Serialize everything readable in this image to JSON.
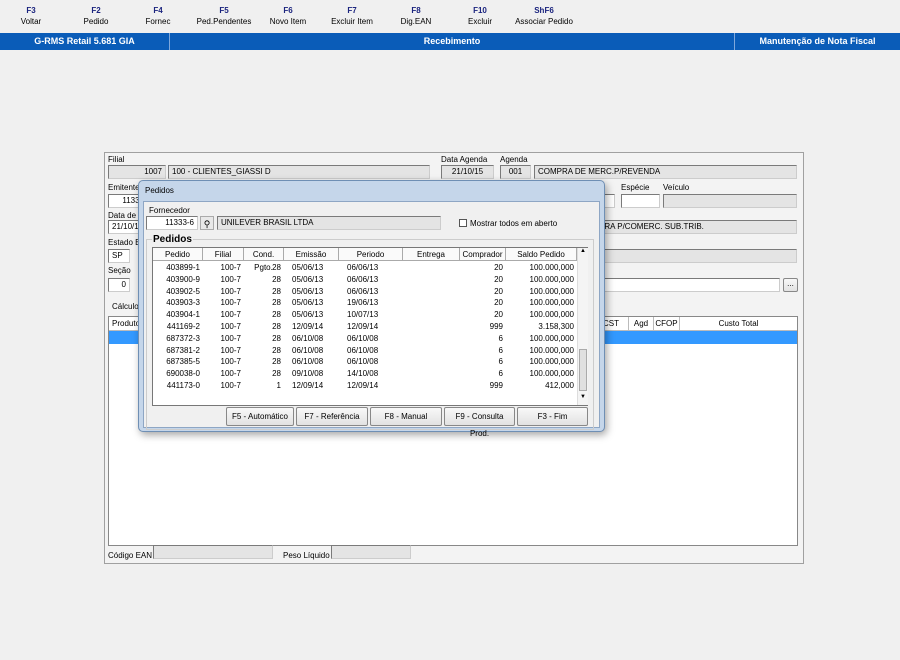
{
  "toolbar": [
    {
      "key": "F3",
      "label": "Voltar"
    },
    {
      "key": "F2",
      "label": "Pedido"
    },
    {
      "key": "F4",
      "label": "Fornec"
    },
    {
      "key": "F5",
      "label": "Ped.Pendentes"
    },
    {
      "key": "F6",
      "label": "Novo Item"
    },
    {
      "key": "F7",
      "label": "Excluir Item"
    },
    {
      "key": "F8",
      "label": "Dig.EAN"
    },
    {
      "key": "F10",
      "label": "Excluir"
    },
    {
      "key": "ShF6",
      "label": "Associar Pedido"
    }
  ],
  "titlebar": {
    "app": "G-RMS Retail 5.681 GIA",
    "module": "Recebimento",
    "screen": "Manutenção de Nota Fiscal",
    "color": "#0a5cb8"
  },
  "form": {
    "filial_label": "Filial",
    "filial_code": "1007",
    "filial_name": "100 - CLIENTES_GIASSI D",
    "data_agenda_label": "Data Agenda",
    "data_agenda": "21/10/15",
    "agenda_label": "Agenda",
    "agenda_code": "001",
    "agenda_desc": "COMPRA DE MERC.P/REVENDA",
    "emitente_label": "Emitente",
    "emitente": "11333",
    "especie_label": "Espécie",
    "veiculo_label": "Veículo",
    "data_label": "Data de",
    "data": "21/10/1",
    "operacao": "PRA P/COMERC. SUB.TRIB.",
    "estado_label": "Estado E",
    "estado": "SP",
    "secao_label": "Seção",
    "secao": "0",
    "ellipsis": "...",
    "tab_calculo": "Cálculo",
    "grid_headers": {
      "produto": "Produto",
      "cst": "CST",
      "agd": "Agd",
      "cfop": "CFOP",
      "custo_total": "Custo Total"
    },
    "codigo_ean_label": "Código EAN",
    "peso_liquido_label": "Peso Líquido"
  },
  "dialog": {
    "title": "Pedidos",
    "fornecedor_label": "Fornecedor",
    "fornecedor_code": "11333-6",
    "fornecedor_name": "UNILEVER BRASIL LTDA",
    "mostrar_label": "Mostrar todos em aberto",
    "mostrar_checked": false,
    "group_label": "Pedidos",
    "columns": [
      "Pedido",
      "Filial",
      "Cond. Pgto.",
      "Emissão",
      "Periodo",
      "Entrega",
      "Comprador",
      "Saldo Pedido"
    ],
    "rows": [
      [
        "403899-1",
        "100-7",
        "28",
        "05/06/13",
        "06/06/13",
        "",
        "20",
        "100.000,000"
      ],
      [
        "403900-9",
        "100-7",
        "28",
        "05/06/13",
        "06/06/13",
        "",
        "20",
        "100.000,000"
      ],
      [
        "403902-5",
        "100-7",
        "28",
        "05/06/13",
        "06/06/13",
        "",
        "20",
        "100.000,000"
      ],
      [
        "403903-3",
        "100-7",
        "28",
        "05/06/13",
        "19/06/13",
        "",
        "20",
        "100.000,000"
      ],
      [
        "403904-1",
        "100-7",
        "28",
        "05/06/13",
        "10/07/13",
        "",
        "20",
        "100.000,000"
      ],
      [
        "441169-2",
        "100-7",
        "28",
        "12/09/14",
        "12/09/14",
        "",
        "999",
        "3.158,300"
      ],
      [
        "687372-3",
        "100-7",
        "28",
        "06/10/08",
        "06/10/08",
        "",
        "6",
        "100.000,000"
      ],
      [
        "687381-2",
        "100-7",
        "28",
        "06/10/08",
        "06/10/08",
        "",
        "6",
        "100.000,000"
      ],
      [
        "687385-5",
        "100-7",
        "28",
        "06/10/08",
        "06/10/08",
        "",
        "6",
        "100.000,000"
      ],
      [
        "690038-0",
        "100-7",
        "28",
        "09/10/08",
        "14/10/08",
        "",
        "6",
        "100.000,000"
      ],
      [
        "441173-0",
        "100-7",
        "1",
        "12/09/14",
        "12/09/14",
        "",
        "999",
        "412,000"
      ]
    ],
    "buttons": [
      "F5 - Automático",
      "F7 - Referência",
      "F8 - Manual",
      "F9 - Consulta Prod.",
      "F3 - Fim"
    ]
  }
}
